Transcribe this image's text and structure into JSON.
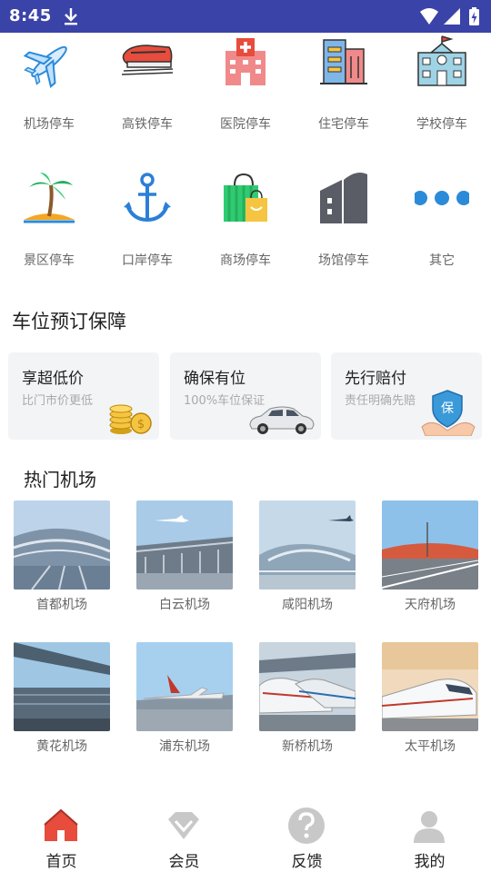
{
  "status_bar": {
    "time": "8:45",
    "icons": [
      "download-icon",
      "wifi-icon",
      "signal-icon",
      "battery-icon"
    ]
  },
  "categories": [
    {
      "label": "机场停车",
      "icon": "airplane-icon"
    },
    {
      "label": "高铁停车",
      "icon": "train-icon"
    },
    {
      "label": "医院停车",
      "icon": "hospital-icon"
    },
    {
      "label": "住宅停车",
      "icon": "residence-icon"
    },
    {
      "label": "学校停车",
      "icon": "school-icon"
    },
    {
      "label": "景区停车",
      "icon": "palm-island-icon"
    },
    {
      "label": "口岸停车",
      "icon": "anchor-icon"
    },
    {
      "label": "商场停车",
      "icon": "shopping-bag-icon"
    },
    {
      "label": "场馆停车",
      "icon": "venue-icon"
    },
    {
      "label": "其它",
      "icon": "more-dots-icon"
    }
  ],
  "guarantee": {
    "title": "车位预订保障",
    "cards": [
      {
        "title": "享超低价",
        "subtitle": "比门市价更低",
        "icon": "coins-icon"
      },
      {
        "title": "确保有位",
        "subtitle": "100%车位保证",
        "icon": "car-icon"
      },
      {
        "title": "先行赔付",
        "subtitle": "责任明确先赔",
        "icon": "shield-hand-icon",
        "shield_text": "保"
      }
    ]
  },
  "hot_airports": {
    "title": "热门机场",
    "items": [
      {
        "name": "首都机场"
      },
      {
        "name": "白云机场"
      },
      {
        "name": "咸阳机场"
      },
      {
        "name": "天府机场"
      },
      {
        "name": "黄花机场"
      },
      {
        "name": "浦东机场"
      },
      {
        "name": "新桥机场"
      },
      {
        "name": "太平机场"
      }
    ]
  },
  "bottom_nav": [
    {
      "label": "首页",
      "icon": "home-icon",
      "active": true
    },
    {
      "label": "会员",
      "icon": "diamond-icon",
      "active": false
    },
    {
      "label": "反馈",
      "icon": "question-icon",
      "active": false
    },
    {
      "label": "我的",
      "icon": "user-icon",
      "active": false
    }
  ],
  "colors": {
    "status_bar": "#3a43a8",
    "accent_red": "#e74c3c",
    "inactive_icon": "#c8c8c8"
  }
}
